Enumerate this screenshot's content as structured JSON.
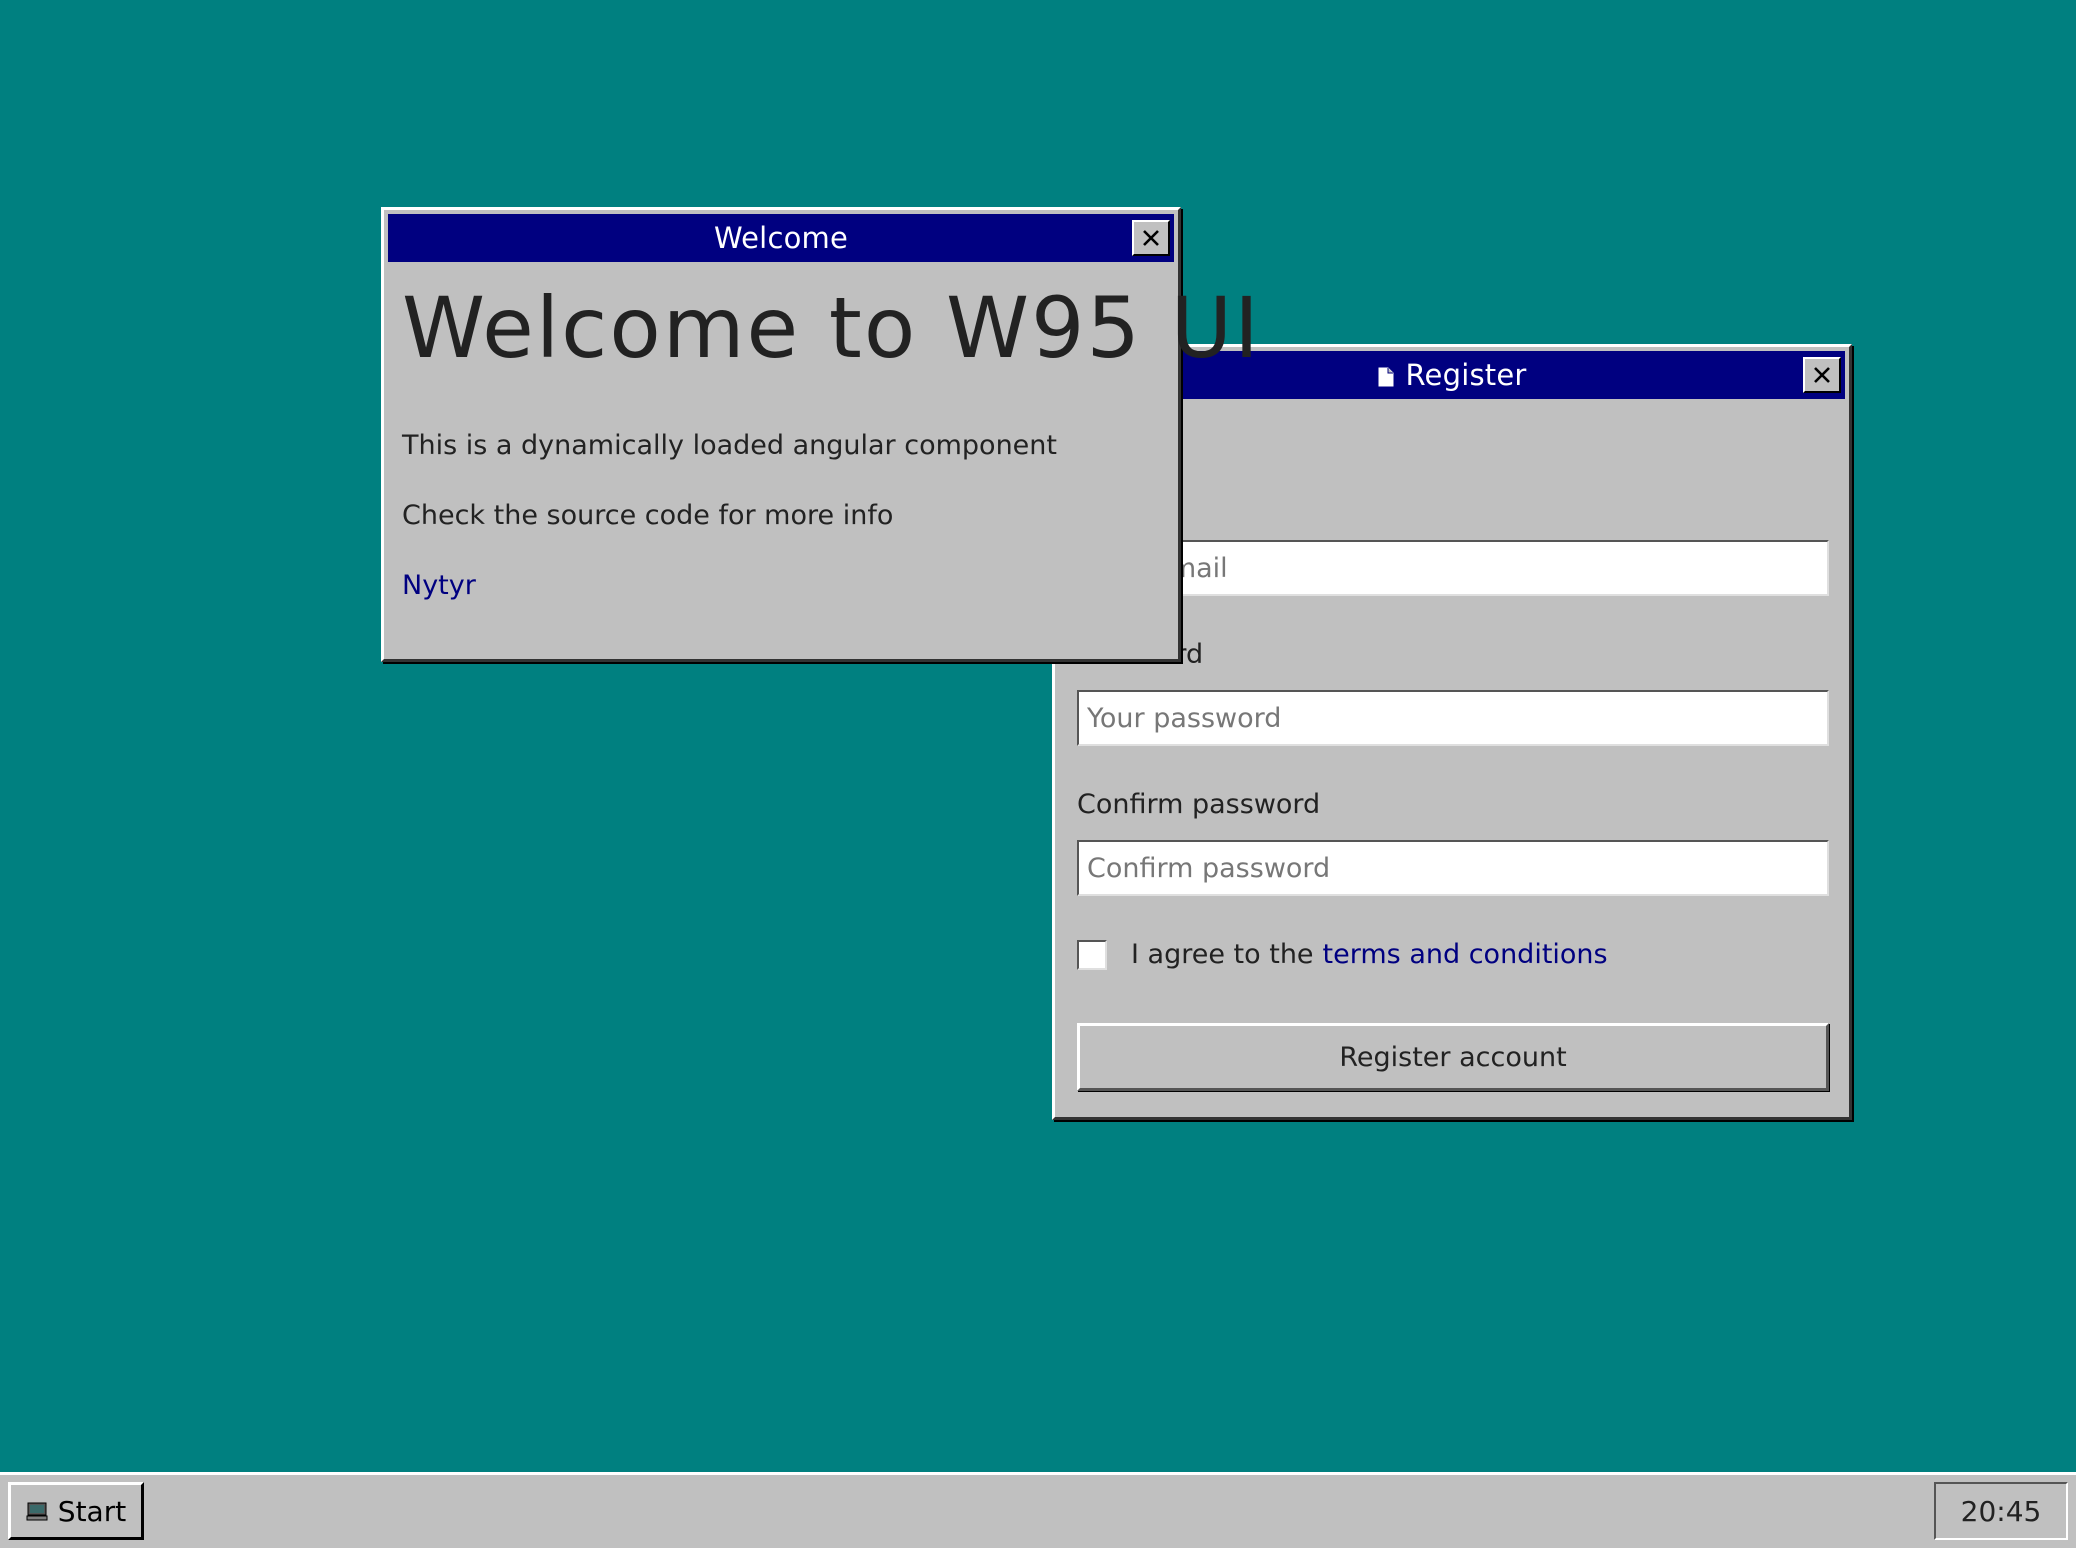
{
  "welcome_window": {
    "title": "Welcome",
    "heading": "Welcome to W95 UI",
    "paragraph1": "This is a dynamically loaded angular component",
    "paragraph2": "Check the source code for more info",
    "link_label": "Nytyr"
  },
  "register_window": {
    "title": "Register",
    "title_icon": "document-icon",
    "email_field": {
      "value": "",
      "placeholder": "Your email"
    },
    "password_label": "Password",
    "password_field": {
      "value": "",
      "placeholder": "Your password"
    },
    "confirm_label": "Confirm password",
    "confirm_field": {
      "value": "",
      "placeholder": "Confirm password"
    },
    "agree_text": "I agree to the",
    "terms_link": "terms and conditions",
    "agree_checked": false,
    "submit_label": "Register account"
  },
  "taskbar": {
    "start_label": "Start",
    "start_icon": "computer-icon",
    "clock": "20:45"
  },
  "colors": {
    "desktop": "#008080",
    "titlebar": "#000080",
    "window_face": "#c0c0c0",
    "link": "#000080"
  }
}
